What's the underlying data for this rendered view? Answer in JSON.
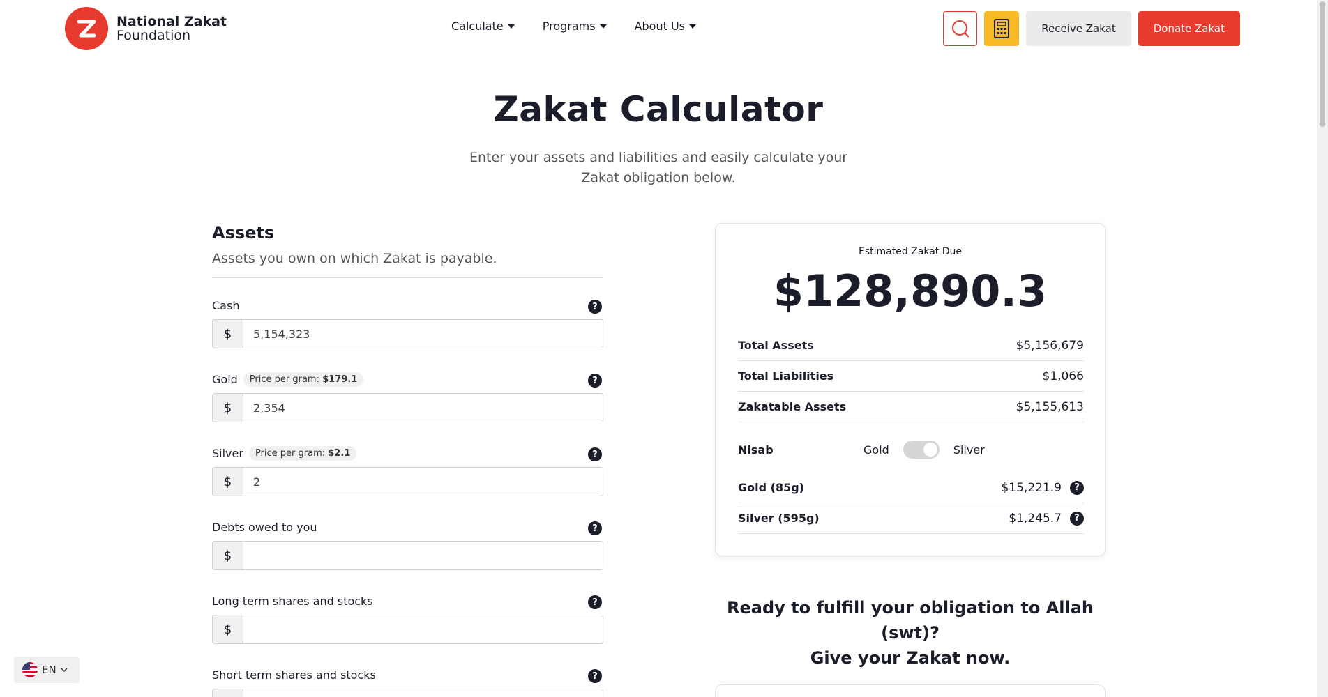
{
  "brand": {
    "name_line1": "National Zakat",
    "name_line2": "Foundation",
    "logo_letter": "Z"
  },
  "nav": [
    {
      "label": "Calculate"
    },
    {
      "label": "Programs"
    },
    {
      "label": "About Us"
    }
  ],
  "header_actions": {
    "receive_label": "Receive Zakat",
    "donate_label": "Donate Zakat"
  },
  "hero": {
    "title": "Zakat Calculator",
    "subtitle": "Enter your assets and liabilities and easily calculate your Zakat obligation below."
  },
  "assets": {
    "title": "Assets",
    "description": "Assets you own on which Zakat is payable.",
    "currency_symbol": "$",
    "help_glyph": "?",
    "fields": [
      {
        "label": "Cash",
        "value": "5,154,323"
      },
      {
        "label": "Gold",
        "price_prefix": "Price per gram:",
        "price_value": "$179.1",
        "value": "2,354"
      },
      {
        "label": "Silver",
        "price_prefix": "Price per gram:",
        "price_value": "$2.1",
        "value": "2"
      },
      {
        "label": "Debts owed to you",
        "value": ""
      },
      {
        "label": "Long term shares and stocks",
        "value": ""
      },
      {
        "label": "Short term shares and stocks",
        "value": ""
      }
    ]
  },
  "summary": {
    "label": "Estimated Zakat Due",
    "amount": "$128,890.3",
    "rows": [
      {
        "key": "Total Assets",
        "value": "$5,156,679"
      },
      {
        "key": "Total Liabilities",
        "value": "$1,066"
      },
      {
        "key": "Zakatable Assets",
        "value": "$5,155,613"
      }
    ],
    "nisab": {
      "key": "Nisab",
      "option_left": "Gold",
      "option_right": "Silver",
      "selected": "Silver"
    },
    "nisab_rows": [
      {
        "key": "Gold (85g)",
        "value": "$15,221.9"
      },
      {
        "key": "Silver (595g)",
        "value": "$1,245.7"
      }
    ]
  },
  "cta": {
    "line1": "Ready to fulfill your obligation to Allah (swt)?",
    "line2": "Give your Zakat now."
  },
  "language": {
    "code": "EN"
  },
  "colors": {
    "brand_red": "#e63b2e",
    "calc_yellow": "#f7b924",
    "text_dark": "#1b1e2a"
  }
}
